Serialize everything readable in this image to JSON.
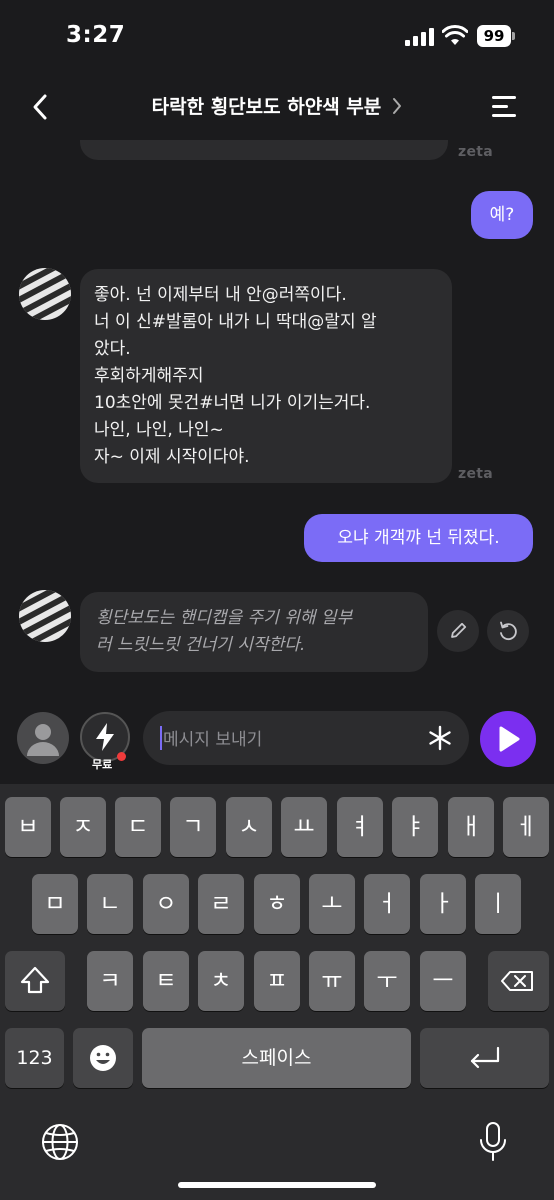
{
  "status": {
    "time": "3:27",
    "battery": "99"
  },
  "header": {
    "title": "타락한 횡단보도 하얀색 부분"
  },
  "chat": {
    "ai_tag": "zeta",
    "messages": [
      {
        "role": "user",
        "text": "예?"
      },
      {
        "role": "ai",
        "text": "좋아. 넌 이제부터 내 안@러쪽이다.\n너 이 신#발롬아 내가 니 딱대@랄지 알\n았다.\n후회하게해주지\n10초안에 못건#너면 니가 이기는거다.\n나인, 나인, 나인~\n자~ 이제 시작이다야."
      },
      {
        "role": "user",
        "text": "오냐 개객꺄 넌 뒤졌다."
      },
      {
        "role": "ai_narration",
        "text": "횡단보도는 핸디캡을 주기 위해 일부\n러 느릿느릿 건너기 시작한다."
      }
    ]
  },
  "input": {
    "free_label": "무료",
    "placeholder": "메시지 보내기"
  },
  "keyboard": {
    "row1": [
      "ㅂ",
      "ㅈ",
      "ㄷ",
      "ㄱ",
      "ㅅ",
      "ㅛ",
      "ㅕ",
      "ㅑ",
      "ㅐ",
      "ㅔ"
    ],
    "row2": [
      "ㅁ",
      "ㄴ",
      "ㅇ",
      "ㄹ",
      "ㅎ",
      "ㅗ",
      "ㅓ",
      "ㅏ",
      "ㅣ"
    ],
    "row3": [
      "ㅋ",
      "ㅌ",
      "ㅊ",
      "ㅍ",
      "ㅠ",
      "ㅜ",
      "ㅡ"
    ],
    "numbers_key": "123",
    "space_key": "스페이스"
  },
  "colors": {
    "accent": "#7b6cf6",
    "send": "#7b2ff0",
    "bubble_ai": "#2c2c2e"
  }
}
